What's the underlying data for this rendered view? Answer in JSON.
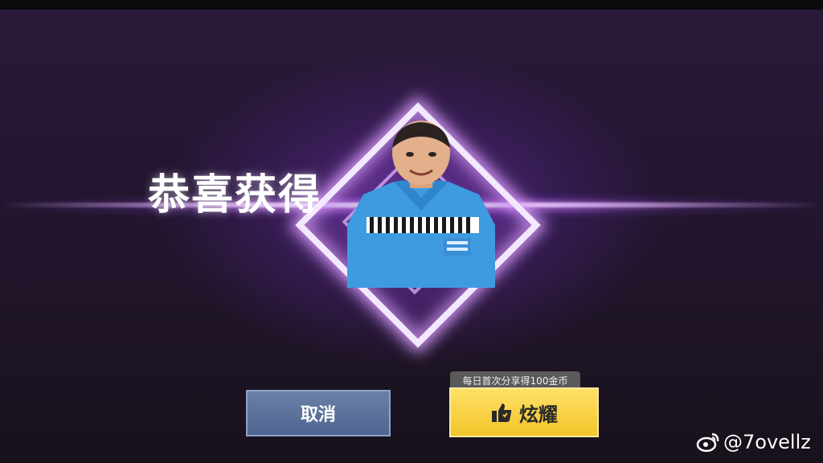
{
  "reward": {
    "title": "恭喜获得"
  },
  "actions": {
    "cancel_label": "取消",
    "share_label": "炫耀",
    "share_tag": "每日首次分享得100金币"
  },
  "watermark": {
    "text": "@7ovellz",
    "icon": "weibo-icon"
  },
  "colors": {
    "accent_purple": "#b070ff",
    "cancel_button": "#5a7099",
    "share_button": "#f4cc36"
  }
}
